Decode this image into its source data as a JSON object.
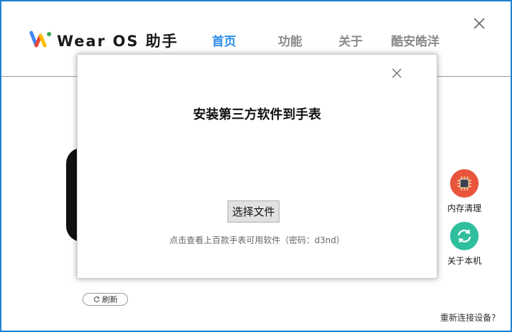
{
  "header": {
    "app_name": "Wear OS 助手",
    "tabs": [
      {
        "label": "首页",
        "active": true
      },
      {
        "label": "功能",
        "active": false
      },
      {
        "label": "关于",
        "active": false
      },
      {
        "label": "酷安皓洋",
        "active": false
      }
    ]
  },
  "side_tools": [
    {
      "label": "内存清理",
      "icon": "cpu-chip-icon",
      "color": "#e8553c"
    },
    {
      "label": "关于本机",
      "icon": "refresh-cycle-icon",
      "color": "#2fbf9e"
    }
  ],
  "refresh_label": "刷新",
  "reconnect_label": "重新连接设备?",
  "modal": {
    "title": "安装第三方软件到手表",
    "choose_file_label": "选择文件",
    "hint": "点击查看上百款手表可用软件（密码：d3nd）"
  },
  "colors": {
    "accent": "#2b8be6",
    "window_border": "#1e7fd6",
    "inactive_tab": "#8a8a8a"
  }
}
